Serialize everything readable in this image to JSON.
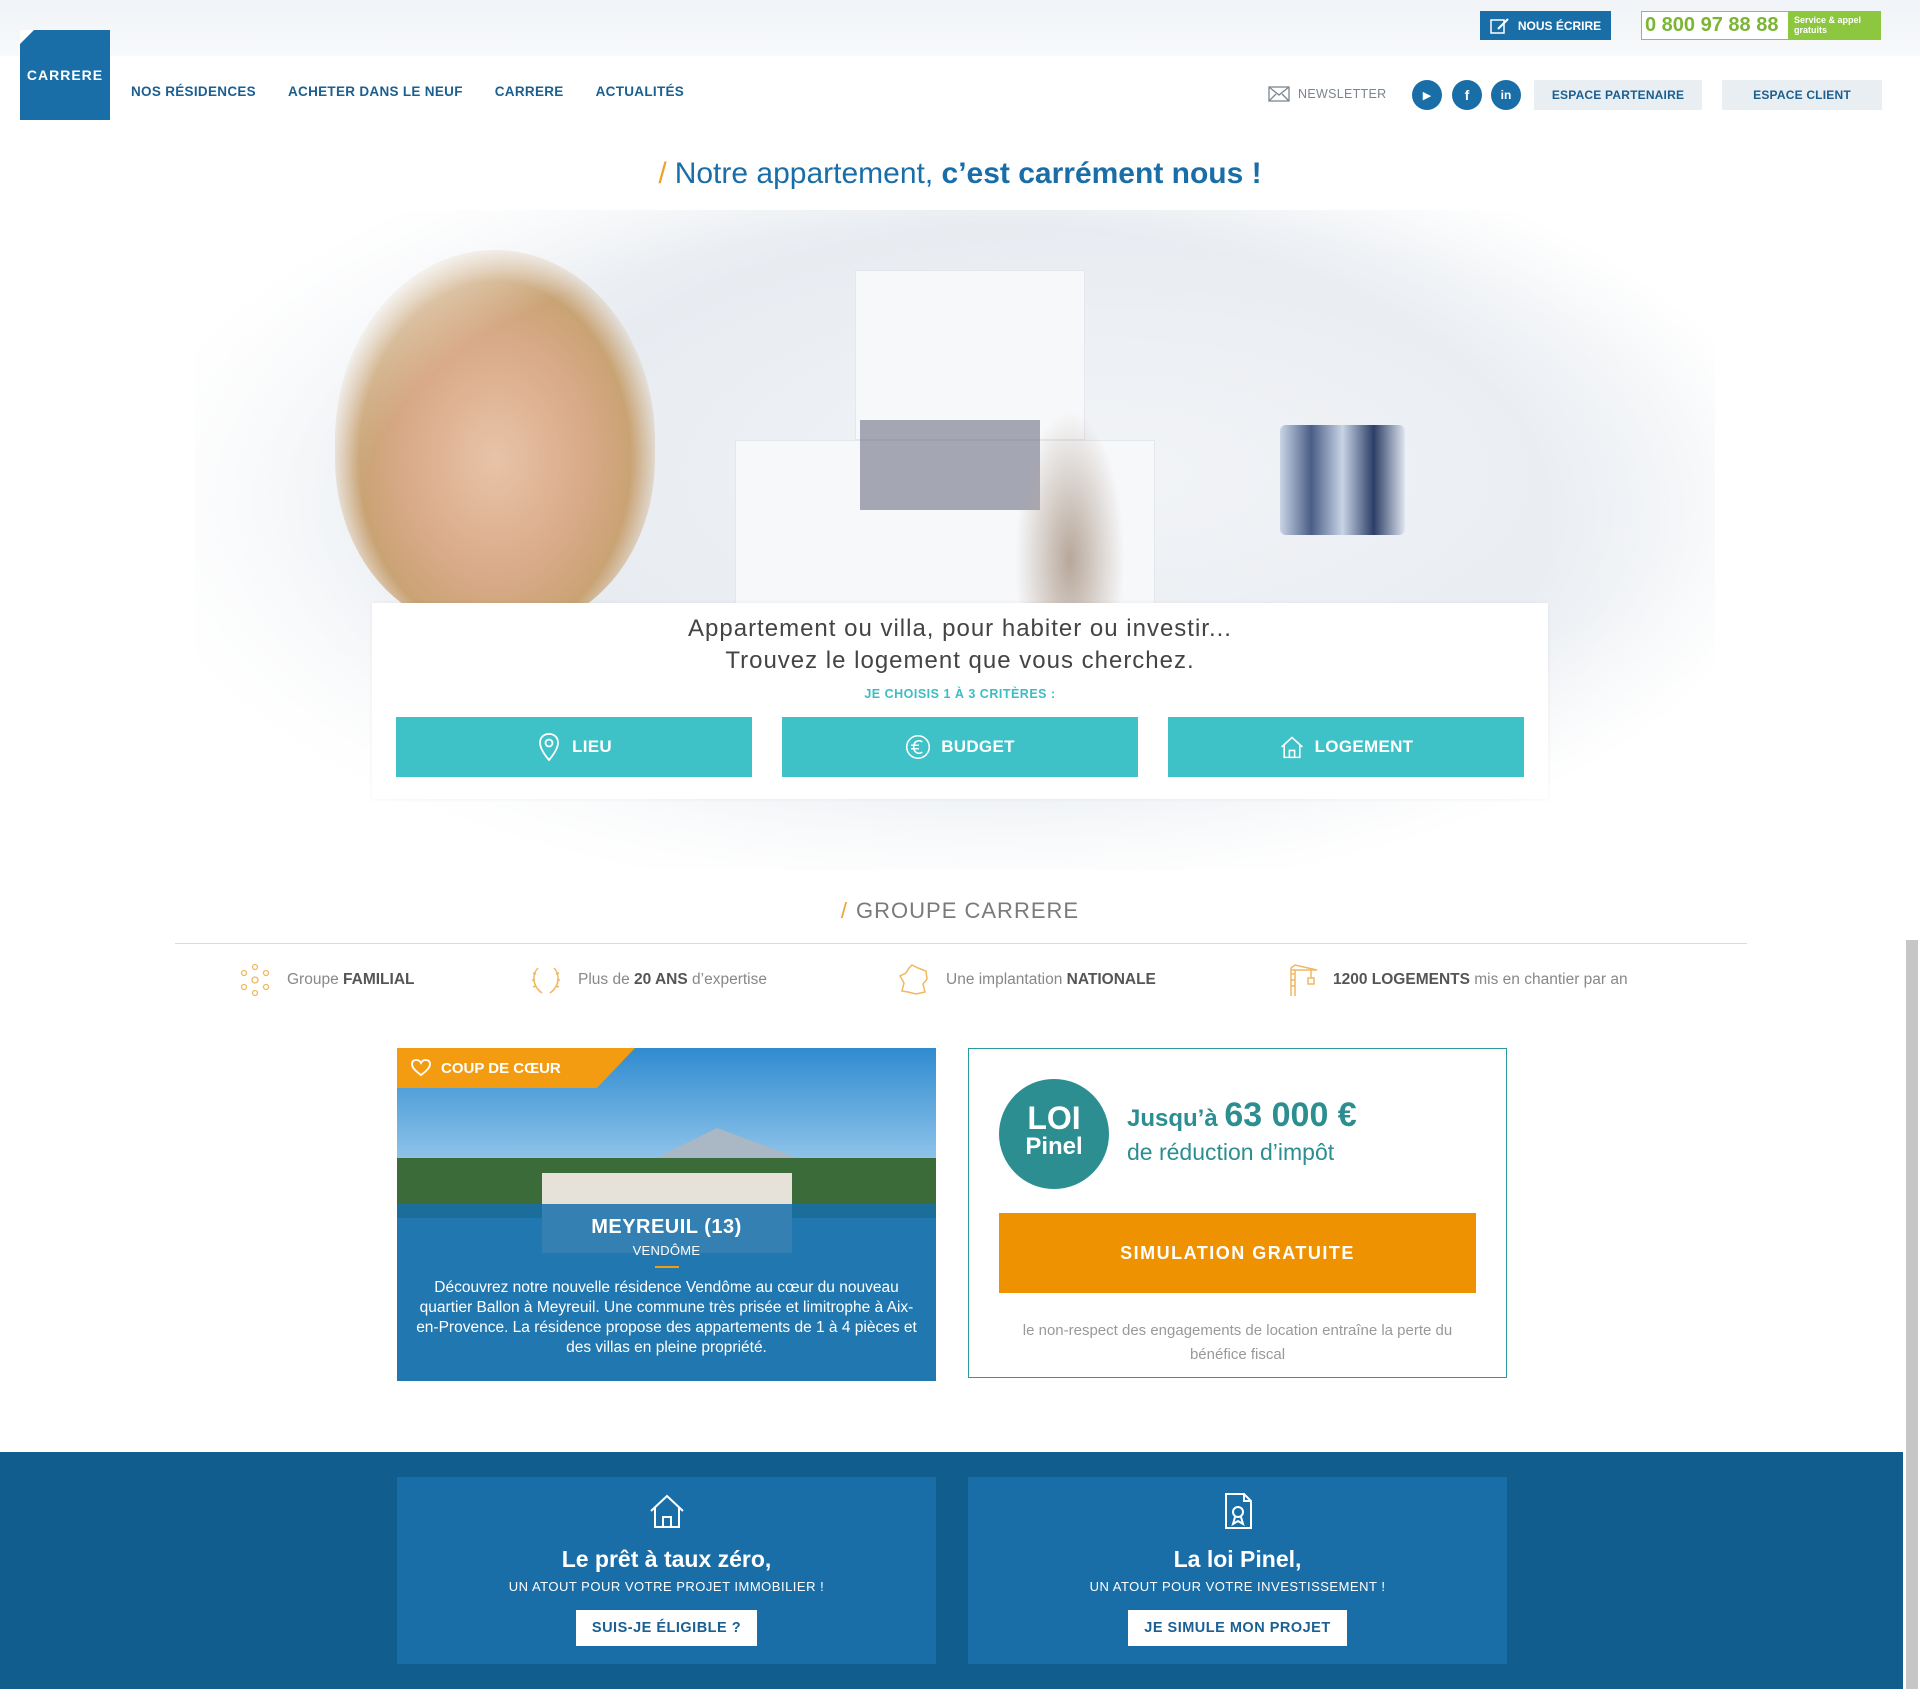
{
  "topbar": {
    "write_label": "NOUS ÉCRIRE",
    "phone_number": "0 800 97 88 88",
    "phone_note": "Service & appel gratuits"
  },
  "header": {
    "logo": "CARRERE",
    "nav": [
      "NOS RÉSIDENCES",
      "ACHETER DANS LE NEUF",
      "CARRERE",
      "ACTUALITÉS"
    ],
    "newsletter": "NEWSLETTER",
    "social": {
      "youtube": "▶",
      "facebook": "f",
      "linkedin": "in"
    },
    "espace_partenaire": "ESPACE PARTENAIRE",
    "espace_client": "ESPACE CLIENT"
  },
  "hero": {
    "slash": "/",
    "title_regular": "Notre appartement, ",
    "title_bold": "c’est carrément nous !",
    "search_line1": "Appartement ou villa, pour habiter ou investir...",
    "search_line2": "Trouvez le logement que vous cherchez.",
    "criteria_label": "JE CHOISIS 1 À 3 CRITÈRES :",
    "criteria_buttons": [
      "LIEU",
      "BUDGET",
      "LOGEMENT"
    ]
  },
  "group": {
    "slash": "/",
    "title": "GROUPE CARRERE",
    "features": [
      {
        "pre": "Groupe ",
        "bold": "FAMILIAL",
        "post": ""
      },
      {
        "pre": "Plus de ",
        "bold": "20 ANS",
        "post": " d’expertise"
      },
      {
        "pre": "Une implantation ",
        "bold": "NATIONALE",
        "post": ""
      },
      {
        "pre": "",
        "bold": "1200 LOGEMENTS",
        "post": " mis en chantier par an"
      }
    ]
  },
  "coup_de_coeur": {
    "badge": "COUP DE CŒUR",
    "title": "MEYREUIL (13)",
    "subtitle": "VENDÔME",
    "description": "Découvrez notre nouvelle résidence Vendôme au cœur du nouveau quartier Ballon à Meyreuil. Une commune très prisée et limitrophe à Aix-en-Provence. La résidence propose des appartements de 1 à 4 pièces et des villas en pleine propriété."
  },
  "pinel": {
    "badge_line1": "LOI",
    "badge_line2": "Pinel",
    "up_to": "Jusqu’à ",
    "amount": "63 000 €",
    "reduction": "de réduction d’impôt",
    "cta": "SIMULATION GRATUITE",
    "legal": "le non-respect des engagements de location entraîne la perte du bénéfice fiscal"
  },
  "promos": [
    {
      "title": "Le prêt à taux zéro,",
      "tagline": "UN ATOUT POUR VOTRE PROJET IMMOBILIER !",
      "cta": "SUIS-JE ÉLIGIBLE ?"
    },
    {
      "title": "La loi Pinel,",
      "tagline": "UN ATOUT POUR VOTRE INVESTISSEMENT !",
      "cta": "JE SIMULE MON PROJET"
    }
  ],
  "colors": {
    "brand_blue": "#1a6ea8",
    "turquoise": "#3fc1c8",
    "orange": "#ef9202",
    "green": "#8dc63f",
    "teal": "#2d8e92"
  }
}
